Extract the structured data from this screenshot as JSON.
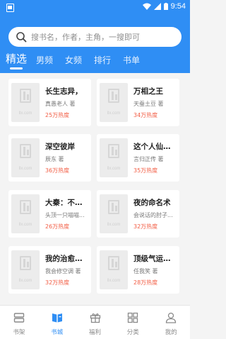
{
  "status_bar": {
    "time": "9:54"
  },
  "search": {
    "placeholder": "搜书名，作者，主角，一搜即可"
  },
  "tabs": [
    {
      "label": "精选",
      "active": true
    },
    {
      "label": "男频",
      "active": false
    },
    {
      "label": "女频",
      "active": false
    },
    {
      "label": "排行",
      "active": false
    },
    {
      "label": "书单",
      "active": false
    }
  ],
  "cover_text": "llx.com",
  "books": [
    {
      "title": "长生志异，",
      "author": "真愚老人 著",
      "heat": "25万热度"
    },
    {
      "title": "万相之王",
      "author": "天蚕土豆 著",
      "heat": "34万热度"
    },
    {
      "title": "深空彼岸",
      "author": "辰东 著",
      "heat": "36万热度"
    },
    {
      "title": "这个人仙太...",
      "author": "言归正传 著",
      "heat": "35万热度"
    },
    {
      "title": "大秦：不装...",
      "author": "头顶一只喵喵...",
      "heat": "26万热度"
    },
    {
      "title": "夜的命名术",
      "author": "会说话的肘子...",
      "heat": "32万热度"
    },
    {
      "title": "我的治愈系...",
      "author": "我会修空调 著",
      "heat": "32万热度"
    },
    {
      "title": "顶级气运，...",
      "author": "任我笑 著",
      "heat": "28万热度"
    }
  ],
  "bottom_nav": [
    {
      "label": "书架",
      "icon": "bookshelf-icon",
      "active": false
    },
    {
      "label": "书城",
      "icon": "book-city-icon",
      "active": true
    },
    {
      "label": "福利",
      "icon": "gift-icon",
      "active": false
    },
    {
      "label": "分类",
      "icon": "category-icon",
      "active": false
    },
    {
      "label": "我的",
      "icon": "user-icon",
      "active": false
    }
  ],
  "colors": {
    "primary": "#2f8ef4",
    "heat": "#f25c43",
    "background": "#f4f4f4"
  }
}
